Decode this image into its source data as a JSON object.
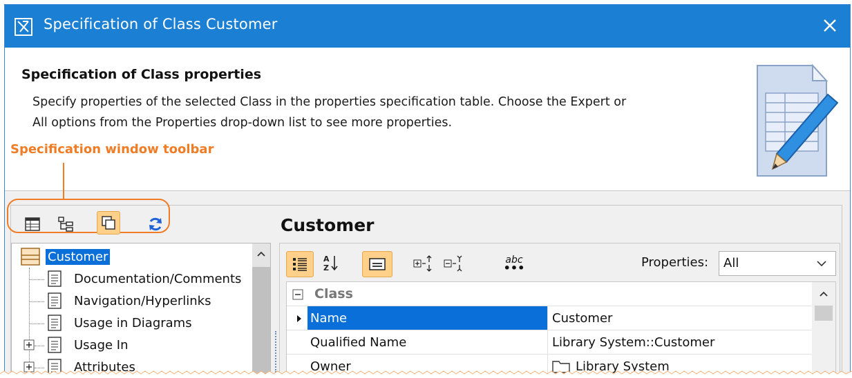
{
  "window": {
    "title": "Specification of Class Customer"
  },
  "header": {
    "title": "Specification of Class properties",
    "description_line1": "Specify properties of the selected Class in the properties specification table. Choose the Expert or",
    "description_line2": "All options from the Properties drop-down list to see more properties."
  },
  "annotation": {
    "label": "Specification window toolbar",
    "color": "#f07c26"
  },
  "toolbar": {
    "buttons": [
      {
        "icon": "table-view-icon",
        "active": false
      },
      {
        "icon": "tree-view-icon",
        "active": false
      },
      {
        "icon": "copy-windows-icon",
        "active": true
      },
      {
        "icon": "refresh-icon",
        "active": false
      }
    ]
  },
  "tree": {
    "items": [
      {
        "label": "Customer",
        "selected": true,
        "icon": "class-icon"
      },
      {
        "label": "Documentation/Comments",
        "icon": "page-icon"
      },
      {
        "label": "Navigation/Hyperlinks",
        "icon": "page-icon"
      },
      {
        "label": "Usage in Diagrams",
        "icon": "page-icon"
      },
      {
        "label": "Usage In",
        "icon": "page-icon",
        "expandable": true
      },
      {
        "label": "Attributes",
        "icon": "page-icon",
        "expandable": true
      }
    ]
  },
  "panel": {
    "title": "Customer",
    "properties_label": "Properties:",
    "properties_value": "All",
    "abc_label": "abc"
  },
  "grid": {
    "category": "Class",
    "rows": [
      {
        "name": "Name",
        "value": "Customer",
        "selected": true
      },
      {
        "name": "Qualified Name",
        "value": "Library System::Customer"
      },
      {
        "name": "Owner",
        "value": "Library System"
      }
    ]
  },
  "colors": {
    "titlebar": "#1b7fd3",
    "selection": "#0a6fd8",
    "active_button": "#ffd089"
  }
}
